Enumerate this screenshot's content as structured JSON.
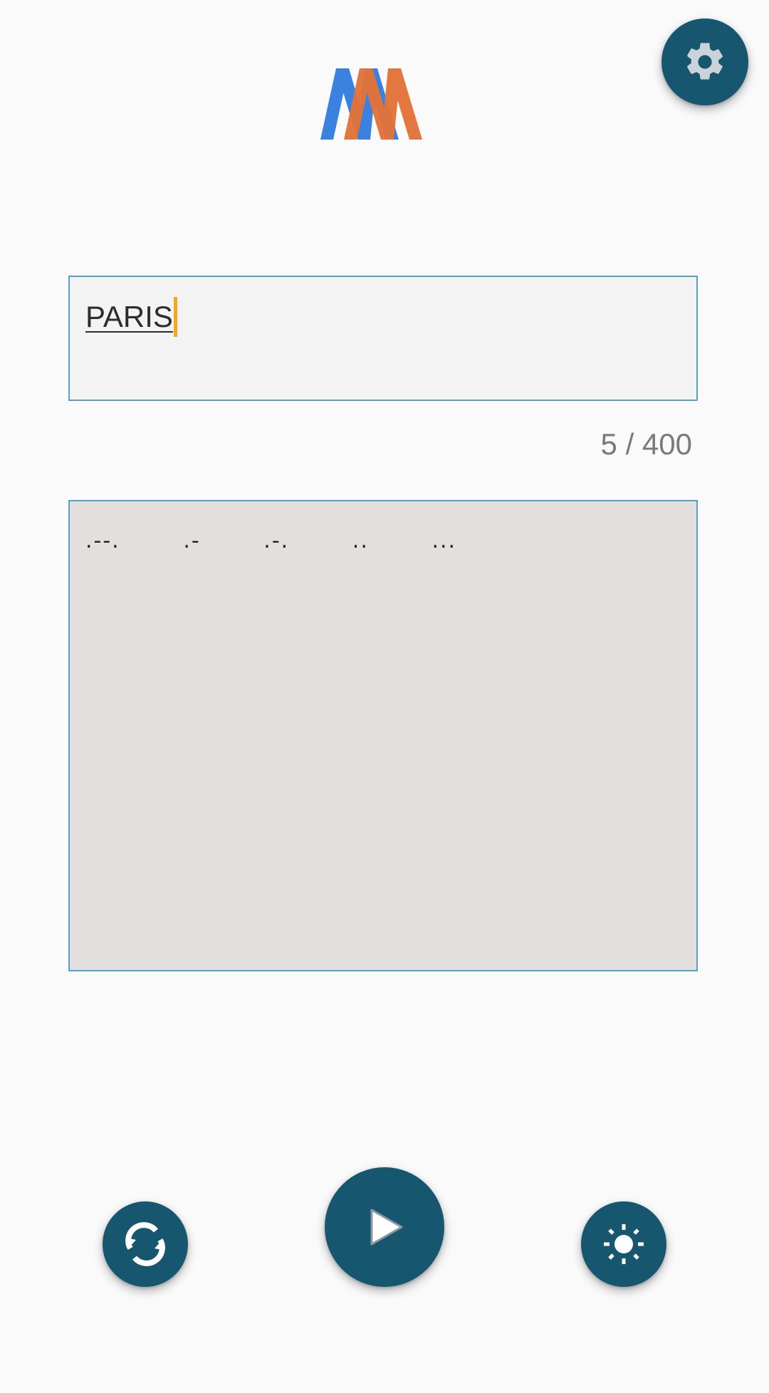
{
  "app": {
    "logo_icon": "mm-logo-icon",
    "colors": {
      "logo_blue": "#3b82e0",
      "logo_orange": "#e2733a",
      "fab_background": "#17566f",
      "input_border": "#56a2c7",
      "caret": "#f4a721"
    }
  },
  "toolbar": {
    "settings_icon": "gear-icon"
  },
  "input": {
    "value": "PARIS",
    "counter": "5 / 400"
  },
  "output": {
    "morse": ".--.   .-   .-.   ..   ..."
  },
  "controls": {
    "reset_icon": "refresh-icon",
    "play_icon": "play-icon",
    "light_icon": "brightness-icon"
  }
}
